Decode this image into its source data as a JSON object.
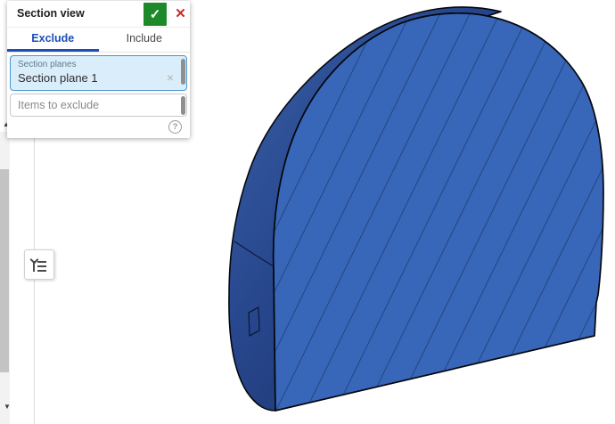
{
  "dialog": {
    "title": "Section view",
    "confirm_glyph": "✓",
    "close_glyph": "✕",
    "tabs": [
      {
        "label": "Exclude",
        "active": true
      },
      {
        "label": "Include",
        "active": false
      }
    ],
    "section_planes_field": {
      "label": "Section planes",
      "value": "Section plane 1",
      "clear_glyph": "×"
    },
    "items_field": {
      "placeholder": "Items to exclude"
    },
    "help_glyph": "?"
  },
  "left_panel": {
    "scroll_up_glyph": "▲",
    "scroll_down_glyph": "▼",
    "toggle_icon": "feature-list-icon"
  },
  "viewport": {
    "content": "sectioned-part-3d-view"
  },
  "colors": {
    "accent_blue": "#1b4fb8",
    "confirm_green": "#1d8a2a",
    "close_red": "#c62828",
    "selected_field_bg": "#d9edfa",
    "selected_field_border": "#4a97d2",
    "section_face_blue": "#3866b8",
    "hatch_line_navy": "#1e3a70",
    "shell_dark_navy": "#182c55",
    "shell_light_navy": "#3a60a8",
    "edge_black": "#05070c"
  }
}
